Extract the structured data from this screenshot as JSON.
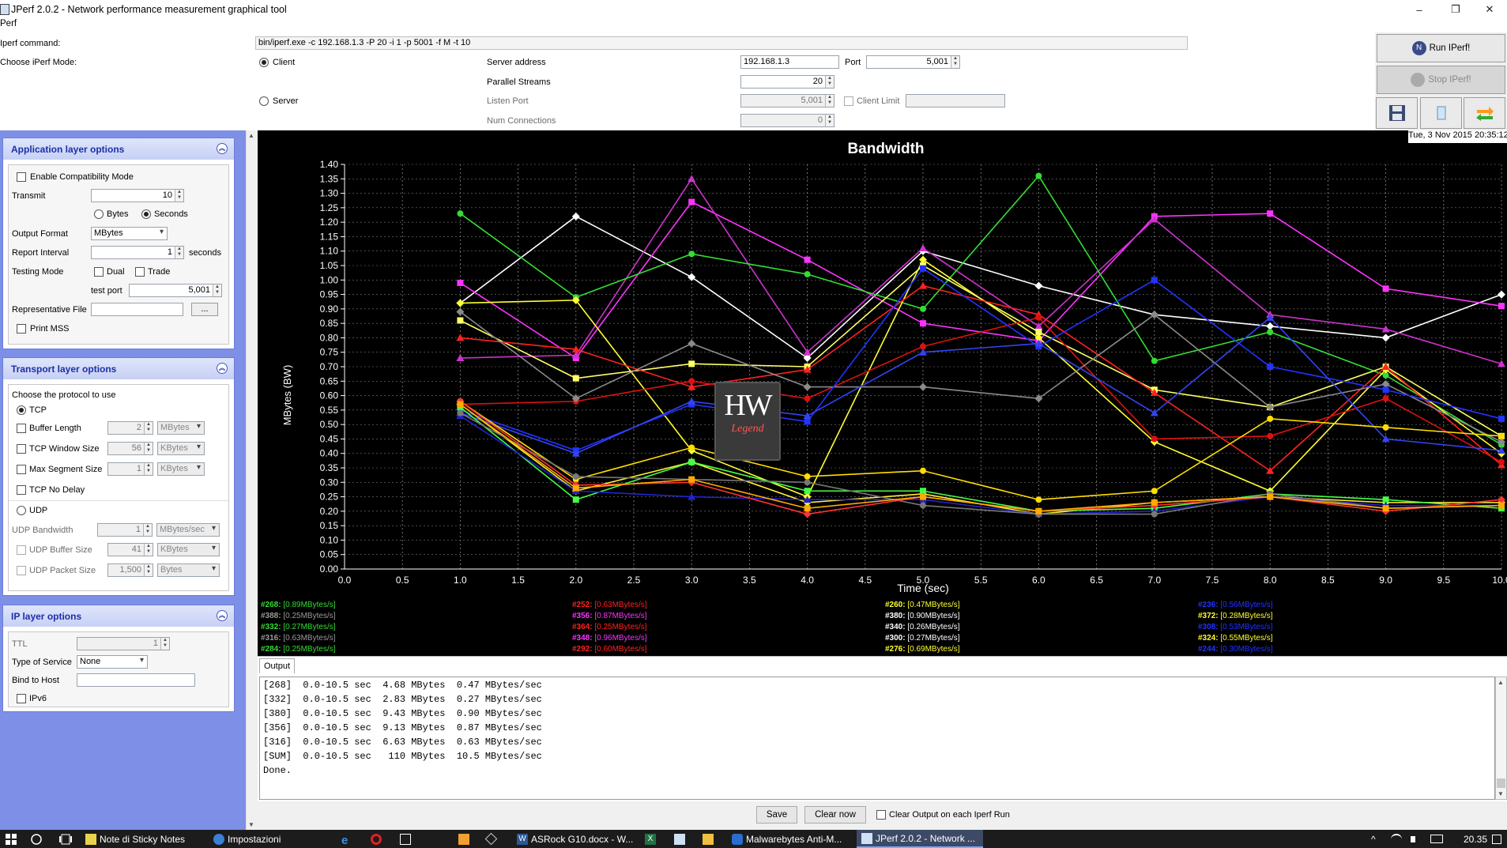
{
  "window": {
    "title": "JPerf 2.0.2 - Network performance measurement graphical tool",
    "minimize": "–",
    "maximize": "❐",
    "close": "✕"
  },
  "menu": {
    "label": "Perf"
  },
  "top": {
    "command_label": "Iperf command:",
    "command_value": "bin/iperf.exe -c 192.168.1.3 -P 20 -i 1 -p 5001 -f M -t 10",
    "mode_label": "Choose iPerf Mode:",
    "client_label": "Client",
    "server_label": "Server",
    "server_address_label": "Server address",
    "server_address_value": "192.168.1.3",
    "port_label": "Port",
    "port_value": "5,001",
    "parallel_label": "Parallel Streams",
    "parallel_value": "20",
    "listen_port_label": "Listen Port",
    "listen_port_value": "5,001",
    "client_limit_label": "Client Limit",
    "num_conn_label": "Num Connections",
    "num_conn_value": "0"
  },
  "right": {
    "run": "Run IPerf!",
    "stop": "Stop IPerf!",
    "date": "Tue, 3 Nov 2015 20:35:12"
  },
  "app": {
    "title": "Application layer options",
    "compat": "Enable Compatibility Mode",
    "transmit_label": "Transmit",
    "transmit_value": "10",
    "bytes": "Bytes",
    "seconds": "Seconds",
    "format_label": "Output Format",
    "format_value": "MBytes",
    "report_label": "Report Interval",
    "report_value": "1",
    "report_unit": "seconds",
    "testing_label": "Testing Mode",
    "dual": "Dual",
    "trade": "Trade",
    "testport_label": "test port",
    "testport_value": "5,001",
    "repfile_label": "Representative File",
    "browse": "...",
    "printmss": "Print MSS"
  },
  "transport": {
    "title": "Transport layer options",
    "choose": "Choose the protocol to use",
    "tcp": "TCP",
    "buflen": "Buffer Length",
    "buflen_value": "2",
    "buflen_unit": "MBytes",
    "window": "TCP Window Size",
    "window_value": "56",
    "window_unit": "KBytes",
    "mss": "Max Segment Size",
    "mss_value": "1",
    "mss_unit": "KBytes",
    "nodelay": "TCP No Delay",
    "udp": "UDP",
    "udpbw": "UDP Bandwidth",
    "udpbw_value": "1",
    "udpbw_unit": "MBytes/sec",
    "udpbuf": "UDP Buffer Size",
    "udpbuf_value": "41",
    "udpbuf_unit": "KBytes",
    "udppkt": "UDP Packet Size",
    "udppkt_value": "1,500",
    "udppkt_unit": "Bytes"
  },
  "ip": {
    "title": "IP layer options",
    "ttl": "TTL",
    "ttl_value": "1",
    "tos": "Type of Service",
    "tos_value": "None",
    "bind": "Bind to Host",
    "ipv6": "IPv6"
  },
  "watermark": {
    "top": "HW",
    "bottom": "Legend"
  },
  "chart_data": {
    "type": "line",
    "title": "Bandwidth",
    "xlabel": "Time (sec)",
    "ylabel": "MBytes (BW)",
    "xlim": [
      0,
      10
    ],
    "ylim": [
      0,
      1.4
    ],
    "xticks": [
      "0.0",
      "0.5",
      "1.0",
      "1.5",
      "2.0",
      "2.5",
      "3.0",
      "3.5",
      "4.0",
      "4.5",
      "5.0",
      "5.5",
      "6.0",
      "6.5",
      "7.0",
      "7.5",
      "8.0",
      "8.5",
      "9.0",
      "9.5",
      "10.0"
    ],
    "yticks": [
      "0.00",
      "0.05",
      "0.10",
      "0.15",
      "0.20",
      "0.25",
      "0.30",
      "0.35",
      "0.40",
      "0.45",
      "0.50",
      "0.55",
      "0.60",
      "0.65",
      "0.70",
      "0.75",
      "0.80",
      "0.85",
      "0.90",
      "0.95",
      "1.00",
      "1.05",
      "1.10",
      "1.15",
      "1.20",
      "1.25",
      "1.30",
      "1.35",
      "1.40"
    ],
    "grid": true,
    "x": [
      1,
      2,
      3,
      4,
      5,
      6,
      7,
      8,
      9,
      10
    ],
    "series": [
      {
        "name": "s1",
        "color": "#ffffff",
        "values": [
          0.92,
          1.22,
          1.01,
          0.73,
          1.1,
          0.98,
          0.88,
          0.84,
          0.8,
          0.95
        ]
      },
      {
        "name": "s2",
        "color": "#ff33ff",
        "values": [
          0.99,
          0.73,
          1.27,
          1.07,
          0.85,
          0.79,
          1.22,
          1.23,
          0.97,
          0.91
        ]
      },
      {
        "name": "s3",
        "color": "#cc33cc",
        "values": [
          0.73,
          0.74,
          1.35,
          0.75,
          1.11,
          0.84,
          1.21,
          0.88,
          0.83,
          0.71
        ]
      },
      {
        "name": "s4",
        "color": "#33dd33",
        "values": [
          1.23,
          0.94,
          1.09,
          1.02,
          0.9,
          1.36,
          0.72,
          0.82,
          0.67,
          0.43
        ]
      },
      {
        "name": "s5",
        "color": "#ffff33",
        "values": [
          0.92,
          0.93,
          0.41,
          0.25,
          1.07,
          0.8,
          0.44,
          0.27,
          0.69,
          0.4
        ]
      },
      {
        "name": "s6",
        "color": "#ffff66",
        "values": [
          0.86,
          0.66,
          0.71,
          0.7,
          1.05,
          0.82,
          0.62,
          0.56,
          0.7,
          0.46
        ]
      },
      {
        "name": "s7",
        "color": "#ff2222",
        "values": [
          0.8,
          0.76,
          0.63,
          0.69,
          0.98,
          0.88,
          0.61,
          0.34,
          0.7,
          0.36
        ]
      },
      {
        "name": "s8",
        "color": "#dd1111",
        "values": [
          0.57,
          0.58,
          0.65,
          0.59,
          0.77,
          0.87,
          0.45,
          0.46,
          0.59,
          0.37
        ]
      },
      {
        "name": "s9",
        "color": "#8a8a8a",
        "values": [
          0.89,
          0.59,
          0.78,
          0.63,
          0.63,
          0.59,
          0.88,
          0.56,
          0.64,
          0.44
        ]
      },
      {
        "name": "s10",
        "color": "#2233ff",
        "values": [
          0.55,
          0.41,
          0.57,
          0.51,
          1.04,
          0.77,
          1.0,
          0.7,
          0.62,
          0.52
        ]
      },
      {
        "name": "s11",
        "color": "#3344ee",
        "values": [
          0.54,
          0.4,
          0.58,
          0.53,
          0.75,
          0.78,
          0.54,
          0.87,
          0.45,
          0.41
        ]
      },
      {
        "name": "s12",
        "color": "#ffdd00",
        "values": [
          0.58,
          0.31,
          0.42,
          0.32,
          0.34,
          0.24,
          0.27,
          0.52,
          0.49,
          0.46
        ]
      },
      {
        "name": "s13",
        "color": "#ffee33",
        "values": [
          0.57,
          0.27,
          0.37,
          0.23,
          0.26,
          0.19,
          0.23,
          0.25,
          0.23,
          0.23
        ]
      },
      {
        "name": "s14",
        "color": "#44ff44",
        "values": [
          0.56,
          0.24,
          0.37,
          0.27,
          0.27,
          0.2,
          0.21,
          0.26,
          0.24,
          0.21
        ]
      },
      {
        "name": "s15",
        "color": "#2222cc",
        "values": [
          0.53,
          0.27,
          0.25,
          0.24,
          0.24,
          0.19,
          0.2,
          0.25,
          0.22,
          0.22
        ]
      },
      {
        "name": "s16",
        "color": "#777777",
        "values": [
          0.54,
          0.32,
          0.31,
          0.3,
          0.22,
          0.19,
          0.19,
          0.26,
          0.21,
          0.22
        ]
      },
      {
        "name": "s17",
        "color": "#ff3333",
        "values": [
          0.58,
          0.29,
          0.3,
          0.19,
          0.25,
          0.2,
          0.22,
          0.25,
          0.2,
          0.24
        ]
      },
      {
        "name": "s18",
        "color": "#ffaa00",
        "values": [
          0.57,
          0.28,
          0.31,
          0.21,
          0.25,
          0.2,
          0.23,
          0.25,
          0.21,
          0.22
        ]
      }
    ]
  },
  "legend": [
    [
      {
        "id": "#268:",
        "val": "[0.89MBytes/s]",
        "color": "#33dd33"
      },
      {
        "id": "#252:",
        "val": "[0.63MBytes/s]",
        "color": "#ff2222"
      },
      {
        "id": "#260:",
        "val": "[0.47MBytes/s]",
        "color": "#ffff33"
      },
      {
        "id": "#236:",
        "val": "[0.56MBytes/s]",
        "color": "#2233ff"
      }
    ],
    [
      {
        "id": "#388:",
        "val": "[0.25MBytes/s]",
        "color": "#9a9a9a"
      },
      {
        "id": "#356:",
        "val": "[0.87MBytes/s]",
        "color": "#ff33ff"
      },
      {
        "id": "#380:",
        "val": "[0.90MBytes/s]",
        "color": "#ffffff"
      },
      {
        "id": "#372:",
        "val": "[0.28MBytes/s]",
        "color": "#ffff33"
      }
    ],
    [
      {
        "id": "#332:",
        "val": "[0.27MBytes/s]",
        "color": "#33dd33"
      },
      {
        "id": "#364:",
        "val": "[0.25MBytes/s]",
        "color": "#ff2222"
      },
      {
        "id": "#340:",
        "val": "[0.26MBytes/s]",
        "color": "#ffffff"
      },
      {
        "id": "#308:",
        "val": "[0.53MBytes/s]",
        "color": "#2233ff"
      }
    ],
    [
      {
        "id": "#316:",
        "val": "[0.63MBytes/s]",
        "color": "#9a9a9a"
      },
      {
        "id": "#348:",
        "val": "[0.96MBytes/s]",
        "color": "#ff33ff"
      },
      {
        "id": "#300:",
        "val": "[0.27MBytes/s]",
        "color": "#ffffff"
      },
      {
        "id": "#324:",
        "val": "[0.55MBytes/s]",
        "color": "#ffff33"
      }
    ],
    [
      {
        "id": "#284:",
        "val": "[0.25MBytes/s]",
        "color": "#33dd33"
      },
      {
        "id": "#292:",
        "val": "[0.60MBytes/s]",
        "color": "#ff2222"
      },
      {
        "id": "#276:",
        "val": "[0.69MBytes/s]",
        "color": "#ffff33"
      },
      {
        "id": "#244:",
        "val": "[0.30MBytes/s]",
        "color": "#2233ff"
      }
    ]
  ],
  "output": {
    "tab": "Output",
    "lines": [
      "[268]  0.0-10.5 sec  4.68 MBytes  0.47 MBytes/sec",
      "[332]  0.0-10.5 sec  2.83 MBytes  0.27 MBytes/sec",
      "[380]  0.0-10.5 sec  9.43 MBytes  0.90 MBytes/sec",
      "[356]  0.0-10.5 sec  9.13 MBytes  0.87 MBytes/sec",
      "[316]  0.0-10.5 sec  6.63 MBytes  0.63 MBytes/sec",
      "[SUM]  0.0-10.5 sec   110 MBytes  10.5 MBytes/sec",
      "Done."
    ],
    "save": "Save",
    "clear": "Clear now",
    "clear_each": "Clear Output on each Iperf Run"
  },
  "taskbar": {
    "stickynotes": "Note di Sticky Notes",
    "settings": "Impostazioni",
    "word": "ASRock G10.docx - W...",
    "malware": "Malwarebytes Anti-M...",
    "jperf": "JPerf 2.0.2 - Network ...",
    "clock": "20.35",
    "caret": "^"
  }
}
